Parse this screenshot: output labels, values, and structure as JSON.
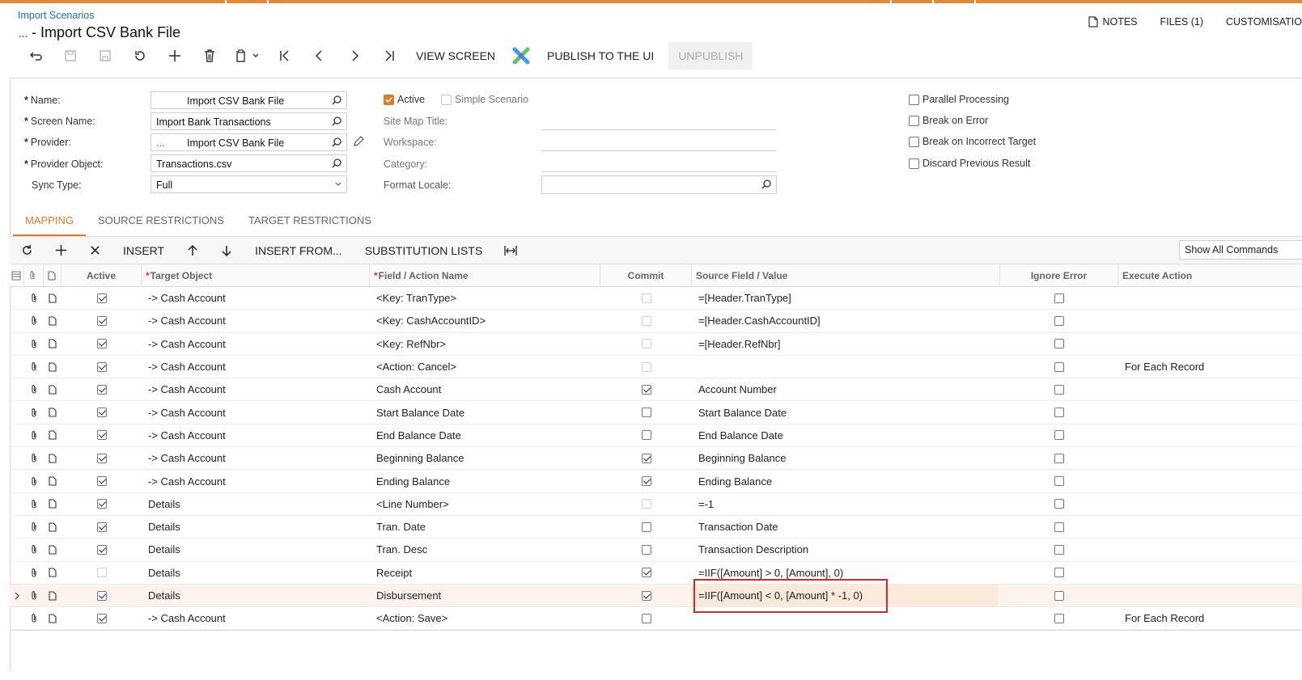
{
  "header": {
    "breadcrumb": "Import Scenarios",
    "title_masked": "...",
    "title": " - Import CSV Bank File",
    "links": {
      "notes": "NOTES",
      "files": "FILES (1)",
      "customisation": "CUSTOMISATIO"
    }
  },
  "toolbar": {
    "view_screen": "VIEW SCREEN",
    "publish": "PUBLISH TO THE UI",
    "unpublish": "UNPUBLISH"
  },
  "form": {
    "name_label": "Name:",
    "name_value": "Import CSV Bank File",
    "screen_label": "Screen Name:",
    "screen_value": "Import Bank Transactions",
    "provider_label": "Provider:",
    "provider_value": "Import CSV Bank File",
    "provider_prefix": "...",
    "provider_object_label": "Provider Object:",
    "provider_object_value": "Transactions.csv",
    "sync_type_label": "Sync Type:",
    "sync_type_value": "Full",
    "active_label": "Active",
    "simple_label": "Simple Scenario",
    "site_map_label": "Site Map Title:",
    "workspace_label": "Workspace:",
    "category_label": "Category:",
    "format_locale_label": "Format Locale:",
    "parallel_label": "Parallel Processing",
    "break_error_label": "Break on Error",
    "break_target_label": "Break on Incorrect Target",
    "discard_label": "Discard Previous Result"
  },
  "tabs": {
    "mapping": "MAPPING",
    "source": "SOURCE RESTRICTIONS",
    "target": "TARGET RESTRICTIONS"
  },
  "gridbar": {
    "insert": "INSERT",
    "insert_from": "INSERT FROM...",
    "substitution": "SUBSTITUTION LISTS",
    "show_all": "Show All Commands"
  },
  "grid": {
    "headers": {
      "active": "Active",
      "target": "Target Object",
      "field": "Field / Action Name",
      "commit": "Commit",
      "source": "Source Field / Value",
      "ignore": "Ignore Error",
      "execute": "Execute Action"
    },
    "rows": [
      {
        "active": true,
        "target": "-> Cash Account",
        "field": "<Key: TranType>",
        "commit": false,
        "commit_dim": true,
        "source": "=[Header.TranType]",
        "execute": ""
      },
      {
        "active": true,
        "target": "-> Cash Account",
        "field": "<Key: CashAccountID>",
        "commit": false,
        "commit_dim": true,
        "source": "=[Header.CashAccountID]",
        "execute": ""
      },
      {
        "active": true,
        "target": "-> Cash Account",
        "field": "<Key: RefNbr>",
        "commit": false,
        "commit_dim": true,
        "source": "=[Header.RefNbr]",
        "execute": ""
      },
      {
        "active": true,
        "target": "-> Cash Account",
        "field": "<Action: Cancel>",
        "commit": false,
        "commit_dim": true,
        "source": "",
        "execute": "For Each Record"
      },
      {
        "active": true,
        "target": "-> Cash Account",
        "field": "Cash Account",
        "commit": true,
        "commit_dim": false,
        "source": "Account Number",
        "execute": ""
      },
      {
        "active": true,
        "target": "-> Cash Account",
        "field": "Start Balance Date",
        "commit": false,
        "commit_dim": false,
        "source": "Start Balance Date",
        "execute": ""
      },
      {
        "active": true,
        "target": "-> Cash Account",
        "field": "End Balance Date",
        "commit": false,
        "commit_dim": false,
        "source": "End Balance Date",
        "execute": ""
      },
      {
        "active": true,
        "target": "-> Cash Account",
        "field": "Beginning Balance",
        "commit": true,
        "commit_dim": false,
        "source": "Beginning Balance",
        "execute": ""
      },
      {
        "active": true,
        "target": "-> Cash Account",
        "field": "Ending Balance",
        "commit": true,
        "commit_dim": false,
        "source": "Ending Balance",
        "execute": ""
      },
      {
        "active": true,
        "target": "Details",
        "field": "<Line Number>",
        "commit": false,
        "commit_dim": true,
        "source": "=-1",
        "execute": ""
      },
      {
        "active": true,
        "target": "Details",
        "field": "Tran. Date",
        "commit": false,
        "commit_dim": false,
        "source": "Transaction Date",
        "execute": ""
      },
      {
        "active": true,
        "target": "Details",
        "field": "Tran. Desc",
        "commit": false,
        "commit_dim": false,
        "source": "Transaction Description",
        "execute": ""
      },
      {
        "active": false,
        "target": "Details",
        "field": "Receipt",
        "commit": true,
        "commit_dim": false,
        "source": "=IIF([Amount] > 0, [Amount], 0)",
        "execute": ""
      },
      {
        "active": true,
        "target": "Details",
        "field": "Disbursement",
        "commit": true,
        "commit_dim": false,
        "source": "=IIF([Amount] < 0, [Amount] * -1, 0)",
        "execute": "",
        "selected": true
      },
      {
        "active": true,
        "target": "-> Cash Account",
        "field": "<Action: Save>",
        "commit": false,
        "commit_dim": false,
        "source": "",
        "execute": "For Each Record"
      }
    ]
  },
  "colors": {
    "accent": "#e07b28",
    "highlight": "#d42a2a",
    "link": "#1a6fb5"
  }
}
